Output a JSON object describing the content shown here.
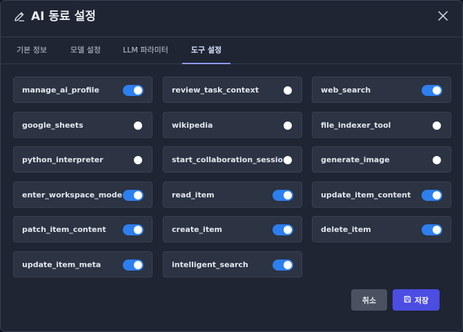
{
  "dialog": {
    "title": "AI 동료 설정",
    "title_icon": "pencil-icon",
    "close_icon": "close-icon"
  },
  "tabs": [
    {
      "label": "기본 정보",
      "active": false
    },
    {
      "label": "모델 설정",
      "active": false
    },
    {
      "label": "LLM 파라미터",
      "active": false
    },
    {
      "label": "도구 설정",
      "active": true
    }
  ],
  "tools": [
    {
      "name": "manage_ai_profile",
      "enabled": true
    },
    {
      "name": "review_task_context",
      "enabled": false
    },
    {
      "name": "web_search",
      "enabled": true
    },
    {
      "name": "google_sheets",
      "enabled": false
    },
    {
      "name": "wikipedia",
      "enabled": false
    },
    {
      "name": "file_indexer_tool",
      "enabled": false
    },
    {
      "name": "python_interpreter",
      "enabled": false
    },
    {
      "name": "start_collaboration_session",
      "enabled": false
    },
    {
      "name": "generate_image",
      "enabled": false
    },
    {
      "name": "enter_workspace_mode",
      "enabled": true
    },
    {
      "name": "read_item",
      "enabled": true
    },
    {
      "name": "update_item_content",
      "enabled": true
    },
    {
      "name": "patch_item_content",
      "enabled": true
    },
    {
      "name": "create_item",
      "enabled": true
    },
    {
      "name": "delete_item",
      "enabled": true
    },
    {
      "name": "update_item_meta",
      "enabled": true
    },
    {
      "name": "intelligent_search",
      "enabled": true
    }
  ],
  "footer": {
    "cancel_label": "취소",
    "save_label": "저장",
    "save_icon": "floppy-disk-icon"
  },
  "colors": {
    "background": "#1f2533",
    "card": "#2c3342",
    "toggle_on": "#2d7ff0",
    "tab_accent": "#8f9cff",
    "save_button": "#4b4de3",
    "cancel_button": "#4a5262"
  }
}
